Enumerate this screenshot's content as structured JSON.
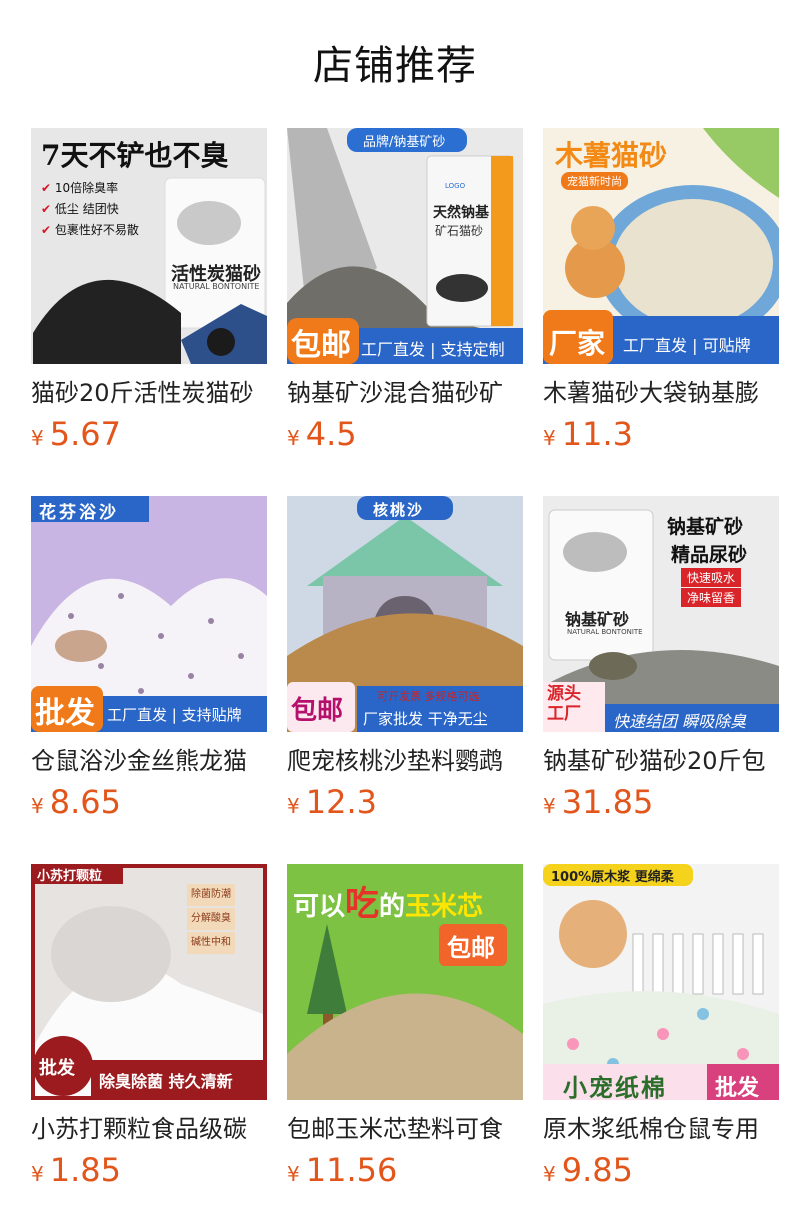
{
  "page": {
    "title": "店铺推荐"
  },
  "products": [
    {
      "name": "猫砂20斤活性炭猫砂",
      "currency": "¥",
      "price": "5.67",
      "img": {
        "headline": "7天不铲也不臭",
        "bullets": [
          "10倍除臭率",
          "低尘 结团快",
          "包裹性好不易散"
        ],
        "pack": "活性炭猫砂",
        "pack_sub": "NATURAL BONTONITE"
      }
    },
    {
      "name": "钠基矿沙混合猫砂矿",
      "currency": "¥",
      "price": "4.5",
      "img": {
        "banner": "品牌/钠基矿砂",
        "pack": "天然钠基",
        "pack_sub": "矿石猫砂",
        "logo": "LOGO",
        "badge": "包邮",
        "strip": "工厂直发 | 支持定制"
      }
    },
    {
      "name": "木薯猫砂大袋钠基膨",
      "currency": "¥",
      "price": "11.3",
      "img": {
        "headline": "木薯猫砂",
        "tag": "宠猫新时尚",
        "badge": "厂家",
        "strip": "工厂直发 | 可贴牌"
      }
    },
    {
      "name": "仓鼠浴沙金丝熊龙猫",
      "currency": "¥",
      "price": "8.65",
      "img": {
        "banner": "花芬浴沙",
        "badge": "批发",
        "strip": "工厂直发 | 支持贴牌"
      }
    },
    {
      "name": "爬宠核桃沙垫料鹦鹉",
      "currency": "¥",
      "price": "12.3",
      "img": {
        "banner": "核桃沙",
        "note": "可开发票 多规格可选",
        "badge": "包邮",
        "strip": "厂家批发 干净无尘"
      }
    },
    {
      "name": "钠基矿砂猫砂20斤包",
      "currency": "¥",
      "price": "31.85",
      "img": {
        "headline1": "钠基矿砂",
        "headline2": "精品尿砂",
        "tag1": "快速吸水",
        "tag2": "净味留香",
        "pack": "钠基矿砂",
        "pack_sub": "NATURAL BONTONITE",
        "badge1": "源头",
        "badge2": "工厂",
        "strip": "快速结团 瞬吸除臭"
      }
    },
    {
      "name": "小苏打颗粒食品级碳",
      "currency": "¥",
      "price": "1.85",
      "img": {
        "banner": "小苏打颗粒",
        "tags": [
          "除菌防潮",
          "分解酸臭",
          "碱性中和"
        ],
        "badge": "批发",
        "strip": "除臭除菌 持久清新"
      }
    },
    {
      "name": "包邮玉米芯垫料可食",
      "currency": "¥",
      "price": "11.56",
      "img": {
        "headline_a": "可以",
        "headline_b": "吃",
        "headline_c": "的",
        "headline_d": "玉米芯",
        "badge": "包邮"
      }
    },
    {
      "name": "原木浆纸棉仓鼠专用",
      "currency": "¥",
      "price": "9.85",
      "img": {
        "banner": "100%原木浆 更绵柔",
        "strip": "小宠纸棉",
        "badge": "批发"
      }
    }
  ]
}
